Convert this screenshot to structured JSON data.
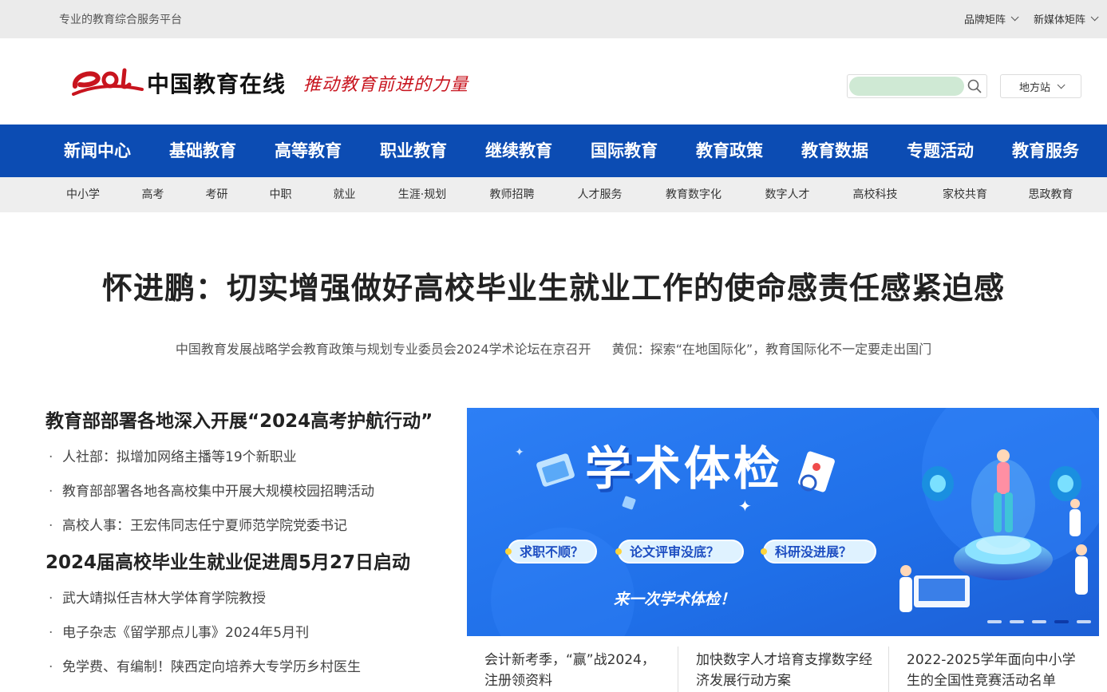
{
  "topbar": {
    "slogan": "专业的教育综合服务平台",
    "links": [
      "品牌矩阵",
      "新媒体矩阵"
    ]
  },
  "header": {
    "logo_mark": "eol",
    "site_name": "中国教育在线",
    "motto": "推动教育前进的力量",
    "search_placeholder": "",
    "region_label": "地方站"
  },
  "main_nav": [
    "新闻中心",
    "基础教育",
    "高等教育",
    "职业教育",
    "继续教育",
    "国际教育",
    "教育政策",
    "教育数据",
    "专题活动",
    "教育服务"
  ],
  "sub_nav": [
    "中小学",
    "高考",
    "考研",
    "中职",
    "就业",
    "生涯·规划",
    "教师招聘",
    "人才服务",
    "教育数字化",
    "数字人才",
    "高校科技",
    "家校共育",
    "思政教育"
  ],
  "headline": "怀进鹏：切实增强做好高校毕业生就业工作的使命感责任感紧迫感",
  "subheadlines": [
    "中国教育发展战略学会教育政策与规划专业委员会2024学术论坛在京召开",
    "黄侃：探索“在地国际化”，教育国际化不一定要走出国门"
  ],
  "news_groups": [
    {
      "title": "教育部部署各地深入开展“2024高考护航行动”",
      "items": [
        "人社部：拟增加网络主播等19个新职业",
        "教育部部署各地各高校集中开展大规模校园招聘活动",
        "高校人事：王宏伟同志任宁夏师范学院党委书记"
      ]
    },
    {
      "title": "2024届高校毕业生就业促进周5月27日启动",
      "items": [
        "武大靖拟任吉林大学体育学院教授",
        "电子杂志《留学那点儿事》2024年5月刊",
        "免学费、有编制！陕西定向培养大专学历乡村医生"
      ]
    }
  ],
  "banner": {
    "title": "学术体检",
    "tags": [
      "求职不顺？",
      "论文评审没底？",
      "科研没进展？"
    ],
    "cta": "来一次学术体检！",
    "dots": 5,
    "active_dot": 4
  },
  "cards": [
    "会计新考季，“赢”战2024，注册领资料",
    "加快数字人才培育支撑数字经济发展行动方案",
    "2022-2025学年面向中小学生的全国性竞赛活动名单"
  ],
  "colors": {
    "brand_blue": "#0c4cb3",
    "brand_red": "#c8141e",
    "banner_blue": "#1f6fe8"
  }
}
